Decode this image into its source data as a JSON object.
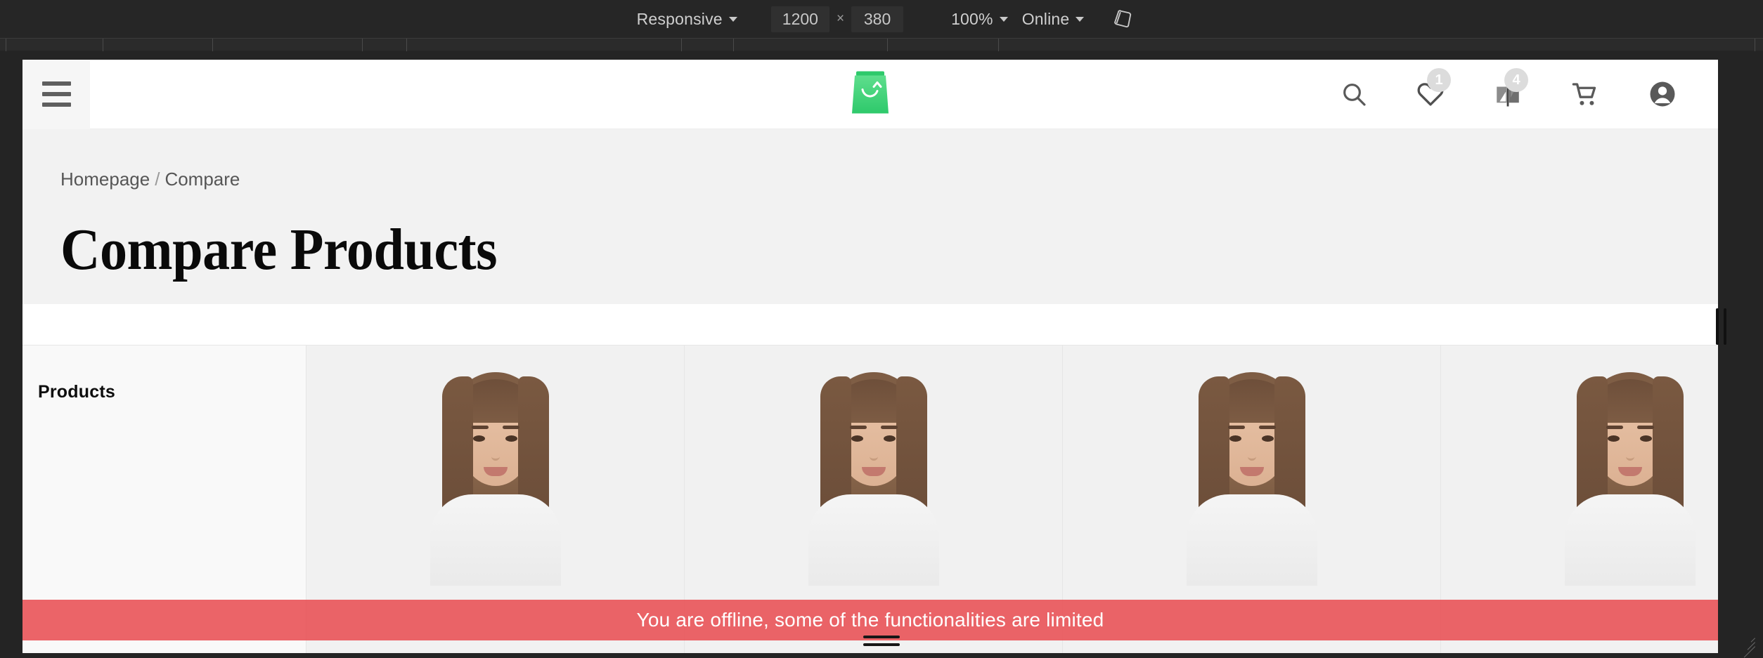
{
  "devtools": {
    "device_preset": "Responsive",
    "width": "1200",
    "height": "380",
    "dimension_separator": "×",
    "zoom": "100%",
    "throttling": "Online",
    "rotate_icon": "rotate-device-icon",
    "caret_icon": "chevron-down-icon"
  },
  "site_header": {
    "menu_icon": "hamburger-menu-icon",
    "logo": {
      "name": "shopping-bag-logo",
      "color": "#3ed07a"
    },
    "icons": [
      {
        "name": "search-icon",
        "badge": null
      },
      {
        "name": "wishlist-heart-icon",
        "badge": "1"
      },
      {
        "name": "compare-icon",
        "badge": "4"
      },
      {
        "name": "shopping-cart-icon",
        "badge": null
      },
      {
        "name": "account-icon",
        "badge": null
      }
    ],
    "badge_color": "#dcdcdc"
  },
  "hero": {
    "breadcrumb": {
      "home": "Homepage",
      "separator": "/",
      "current": "Compare"
    },
    "title": "Compare Products"
  },
  "compare_table": {
    "row_label": "Products",
    "columns": [
      {
        "name": "product-column-1",
        "image": "model-photo-1"
      },
      {
        "name": "product-column-2",
        "image": "model-photo-2"
      },
      {
        "name": "product-column-3",
        "image": "model-photo-3"
      },
      {
        "name": "product-column-4",
        "image": "model-photo-4"
      }
    ]
  },
  "offline_banner": {
    "message": "You are offline, some of the functionalities are limited",
    "color": "#e84e53"
  }
}
